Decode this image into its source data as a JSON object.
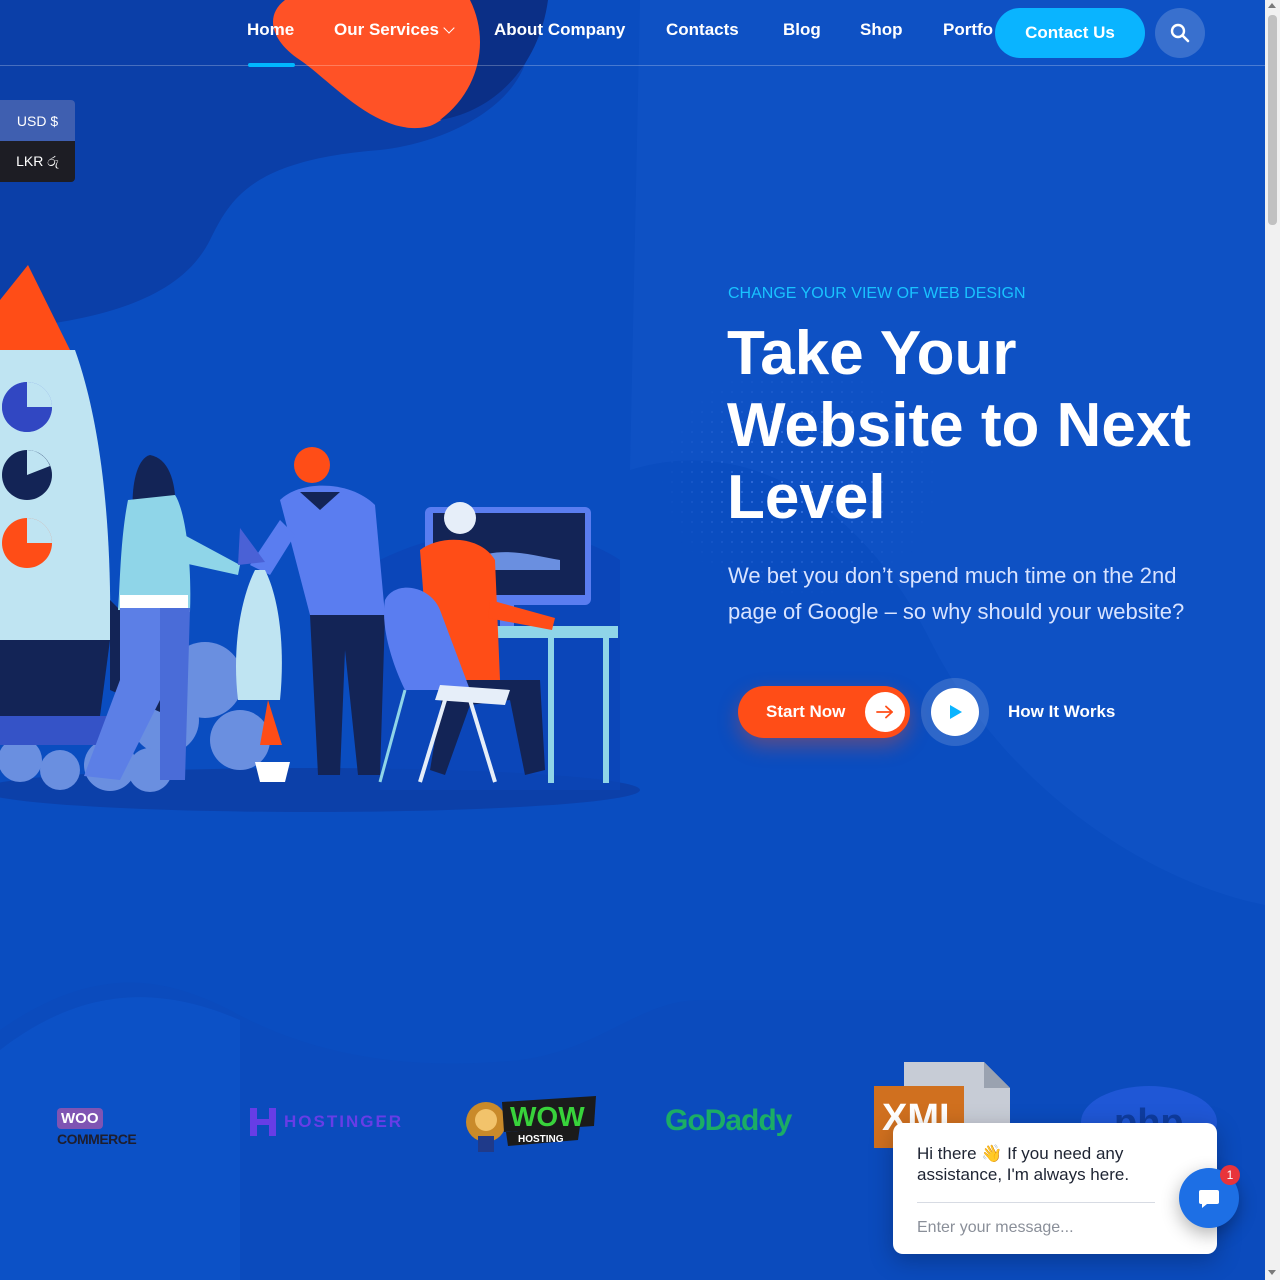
{
  "nav": {
    "items": [
      {
        "label": "Home",
        "active": true
      },
      {
        "label": "Our Services",
        "has_dropdown": true
      },
      {
        "label": "About Company"
      },
      {
        "label": "Contacts"
      },
      {
        "label": "Blog"
      },
      {
        "label": "Shop"
      },
      {
        "label": "Portfo"
      }
    ],
    "contact_button": "Contact Us",
    "search_icon": "search-icon"
  },
  "currency": {
    "options": [
      "USD $",
      "LKR රු"
    ]
  },
  "hero": {
    "eyebrow": "CHANGE YOUR VIEW OF WEB DESIGN",
    "headline_lines": [
      "Take Your",
      "Website to Next",
      "Level"
    ],
    "subtext": "We bet you don’t spend much time on the 2nd page of Google – so why should your website?",
    "start_button": "Start Now",
    "how_link": "How It Works"
  },
  "logos": {
    "woocommerce": {
      "badge": "WOO",
      "word": "COMMERCE"
    },
    "hostinger": "HOSTINGER",
    "wow_hosting": {
      "big": "WOW",
      "small": "HOSTING"
    },
    "godaddy": "GoDaddy",
    "xml": "XML",
    "php": "php"
  },
  "chat": {
    "message": "Hi there 👋 If you need any assistance, I'm always here.",
    "placeholder": "Enter your message...",
    "badge_count": "1"
  },
  "colors": {
    "background": "#0a4dc0",
    "accent_orange": "#ff4d17",
    "accent_cyan": "#0ab4ff",
    "eyebrow_cyan": "#19c3ff"
  }
}
